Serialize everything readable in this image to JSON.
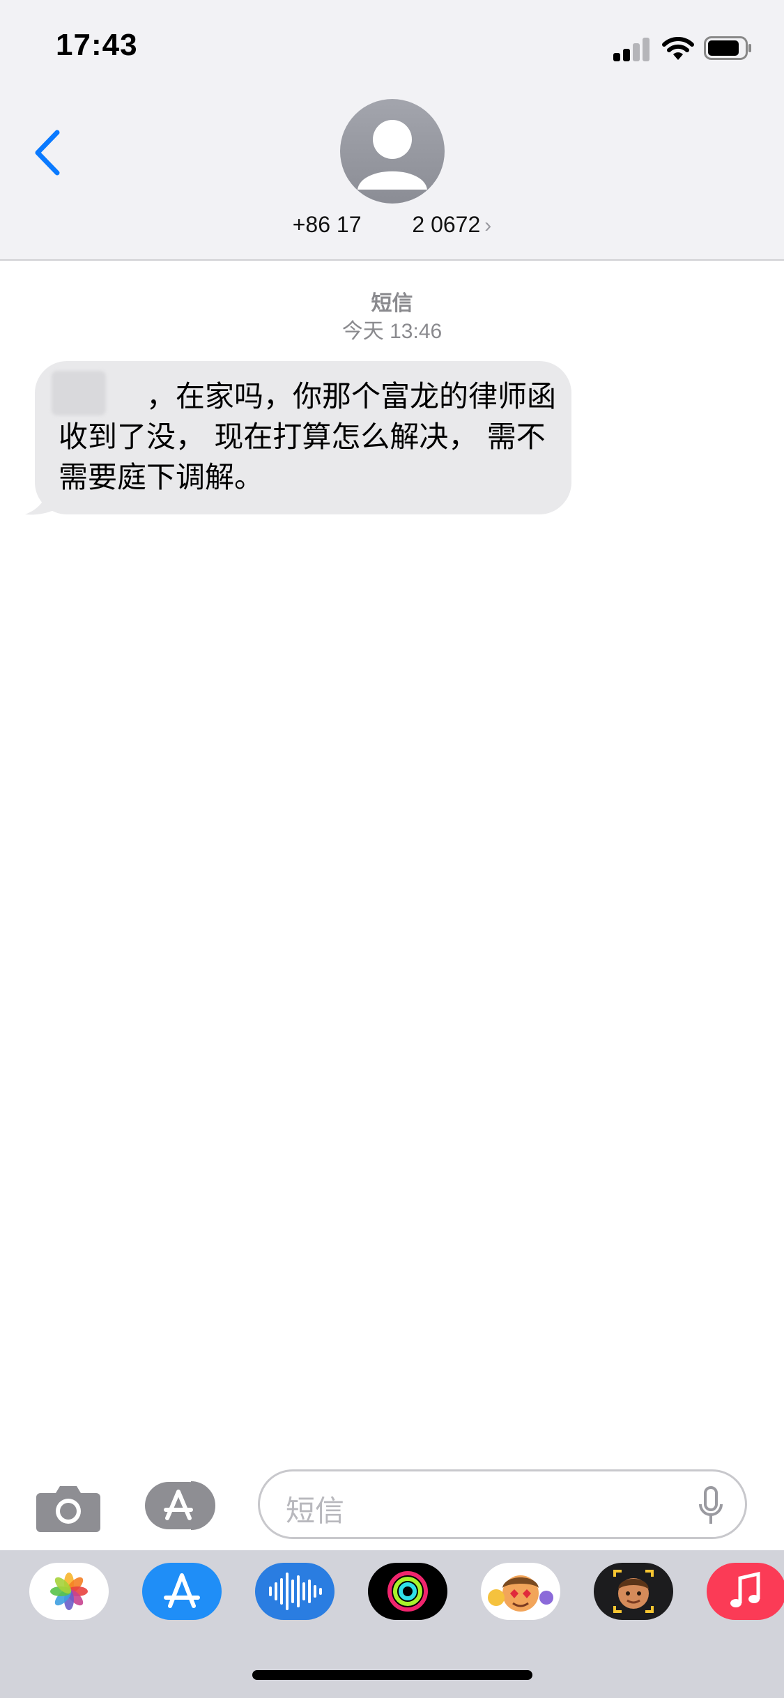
{
  "status_bar": {
    "time": "17:43"
  },
  "header": {
    "contact_number": "+86 17   2 0672",
    "chevron": "›"
  },
  "thread": {
    "service_label": "短信",
    "timestamp": "今天 13:46",
    "messages": [
      {
        "direction": "incoming",
        "text": "　　　，在家吗，你那个富龙的律师函收到了没， 现在打算怎么解决， 需不需要庭下调解。"
      }
    ]
  },
  "input": {
    "placeholder": "短信"
  },
  "app_drawer": {
    "apps": [
      "photos-icon",
      "appstore-icon",
      "audio-message-icon",
      "activity-icon",
      "animoji-icon",
      "memoji-icon",
      "music-icon"
    ]
  },
  "colors": {
    "accent": "#0a7aff",
    "bubble_incoming": "#e9e9eb",
    "header_bg": "#f2f2f5",
    "drawer_bg": "#d2d3da"
  }
}
